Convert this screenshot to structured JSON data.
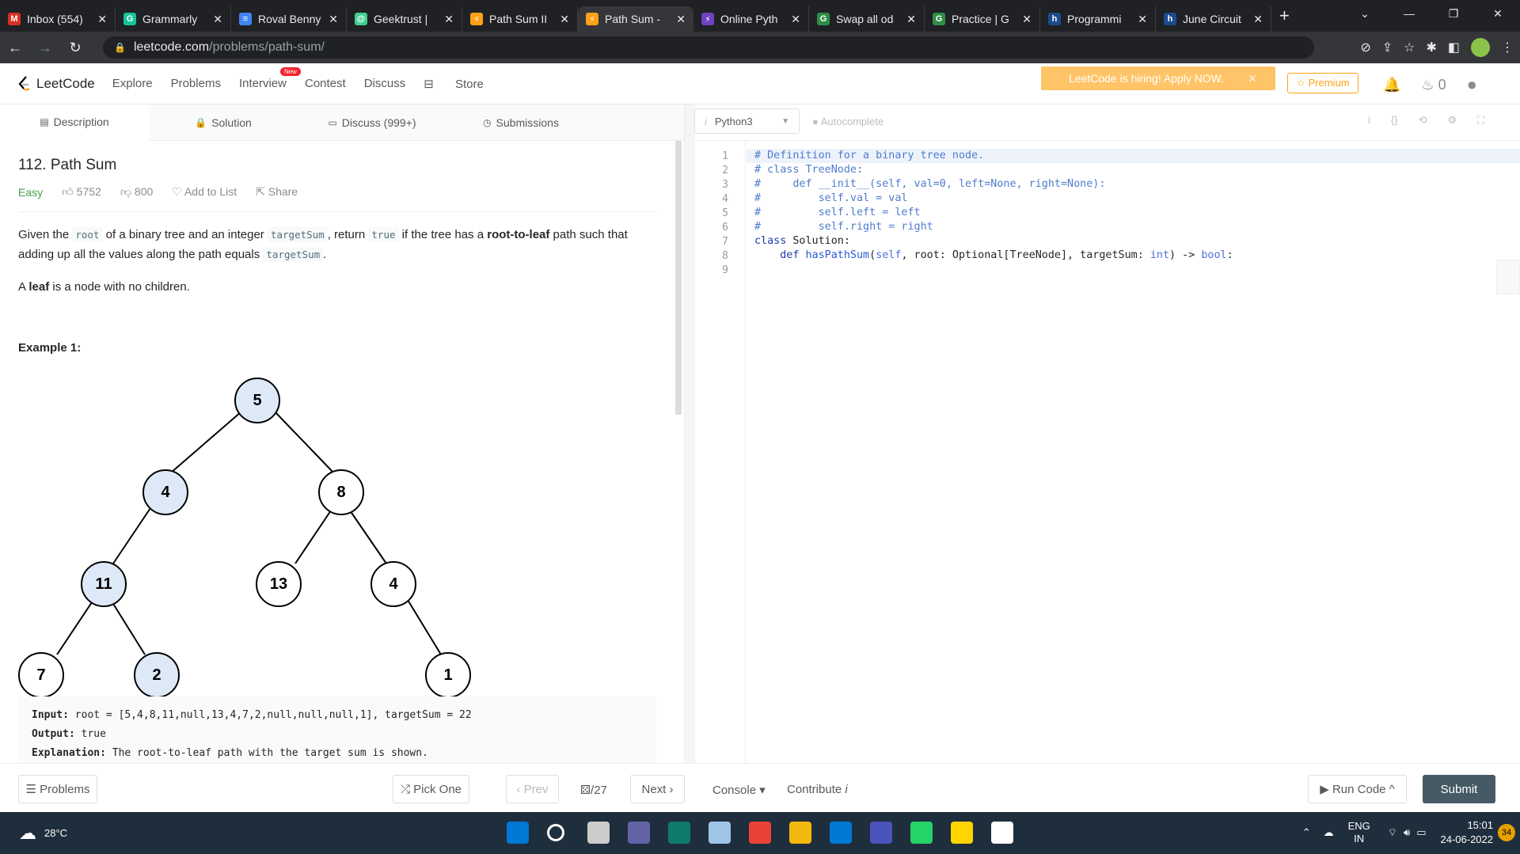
{
  "browser": {
    "tabs": [
      {
        "label": "Inbox (554)",
        "color": "#d93025",
        "glyph": "M"
      },
      {
        "label": "Grammarly",
        "color": "#15c39a",
        "glyph": "G"
      },
      {
        "label": "Roval Benny",
        "color": "#4285f4",
        "glyph": "≡"
      },
      {
        "label": "Geektrust |",
        "color": "#3ecf8e",
        "glyph": "@"
      },
      {
        "label": "Path Sum II",
        "color": "#ffa116",
        "glyph": "⚡"
      },
      {
        "label": "Path Sum -",
        "color": "#ffa116",
        "glyph": "⚡",
        "active": true
      },
      {
        "label": "Online Pyth",
        "color": "#6f42c1",
        "glyph": "⚡"
      },
      {
        "label": "Swap all od",
        "color": "#2f8d46",
        "glyph": "G"
      },
      {
        "label": "Practice | G",
        "color": "#2f8d46",
        "glyph": "G"
      },
      {
        "label": "Programmi",
        "color": "#1a4b8c",
        "glyph": "h"
      },
      {
        "label": "June Circuit",
        "color": "#1a4b8c",
        "glyph": "h"
      }
    ],
    "url_main": "leetcode.com",
    "url_path": "/problems/path-sum/"
  },
  "header": {
    "logo": "LeetCode",
    "menu": [
      "Explore",
      "Problems",
      "Interview",
      "Contest",
      "Discuss"
    ],
    "new_badge": "New",
    "store": "Store",
    "hiring": "LeetCode is hiring! Apply NOW.",
    "premium": "☆ Premium",
    "fire_count": "0"
  },
  "left_tabs": [
    "Description",
    "Solution",
    "Discuss (999+)",
    "Submissions"
  ],
  "problem": {
    "title": "112. Path Sum",
    "difficulty": "Easy",
    "likes": "5752",
    "dislikes": "800",
    "add_to_list": "Add to List",
    "share": "Share",
    "p1_a": "Given the ",
    "p1_code1": "root",
    "p1_b": " of a binary tree and an integer ",
    "p1_code2": "targetSum",
    "p1_c": ", return ",
    "p1_code3": "true",
    "p1_d": " if the tree has a ",
    "p1_bold": "root-to-leaf",
    "p1_e": " path such that adding up all the values along the path equals ",
    "p1_code4": "targetSum",
    "p1_f": ".",
    "p2_a": "A ",
    "p2_bold": "leaf",
    "p2_b": " is a node with no children.",
    "example_label": "Example 1:",
    "tree_nodes": [
      "5",
      "4",
      "8",
      "11",
      "13",
      "4",
      "7",
      "2",
      "1"
    ],
    "input_label": "Input:",
    "input_value": " root = [5,4,8,11,null,13,4,7,2,null,null,null,1], targetSum = 22",
    "output_label": "Output:",
    "output_value": " true",
    "explain_label": "Explanation:",
    "explain_value": " The root-to-leaf path with the target sum is shown."
  },
  "editor": {
    "language": "Python3",
    "autocomplete": "Autocomplete",
    "line_numbers": [
      "1",
      "2",
      "3",
      "4",
      "5",
      "6",
      "7",
      "8",
      "9"
    ]
  },
  "footer": {
    "problems": "☰ Problems",
    "pick_one": "⤮ Pick One",
    "prev": "‹ Prev",
    "page": "/27",
    "next": "Next ›",
    "console": "Console ▾",
    "contribute": "Contribute",
    "run_code": "▶ Run Code ^",
    "submit": "Submit"
  },
  "taskbar": {
    "weather": "28°C",
    "lang1": "ENG",
    "lang2": "IN",
    "time": "15:01",
    "date": "24-06-2022",
    "notif": "34"
  }
}
